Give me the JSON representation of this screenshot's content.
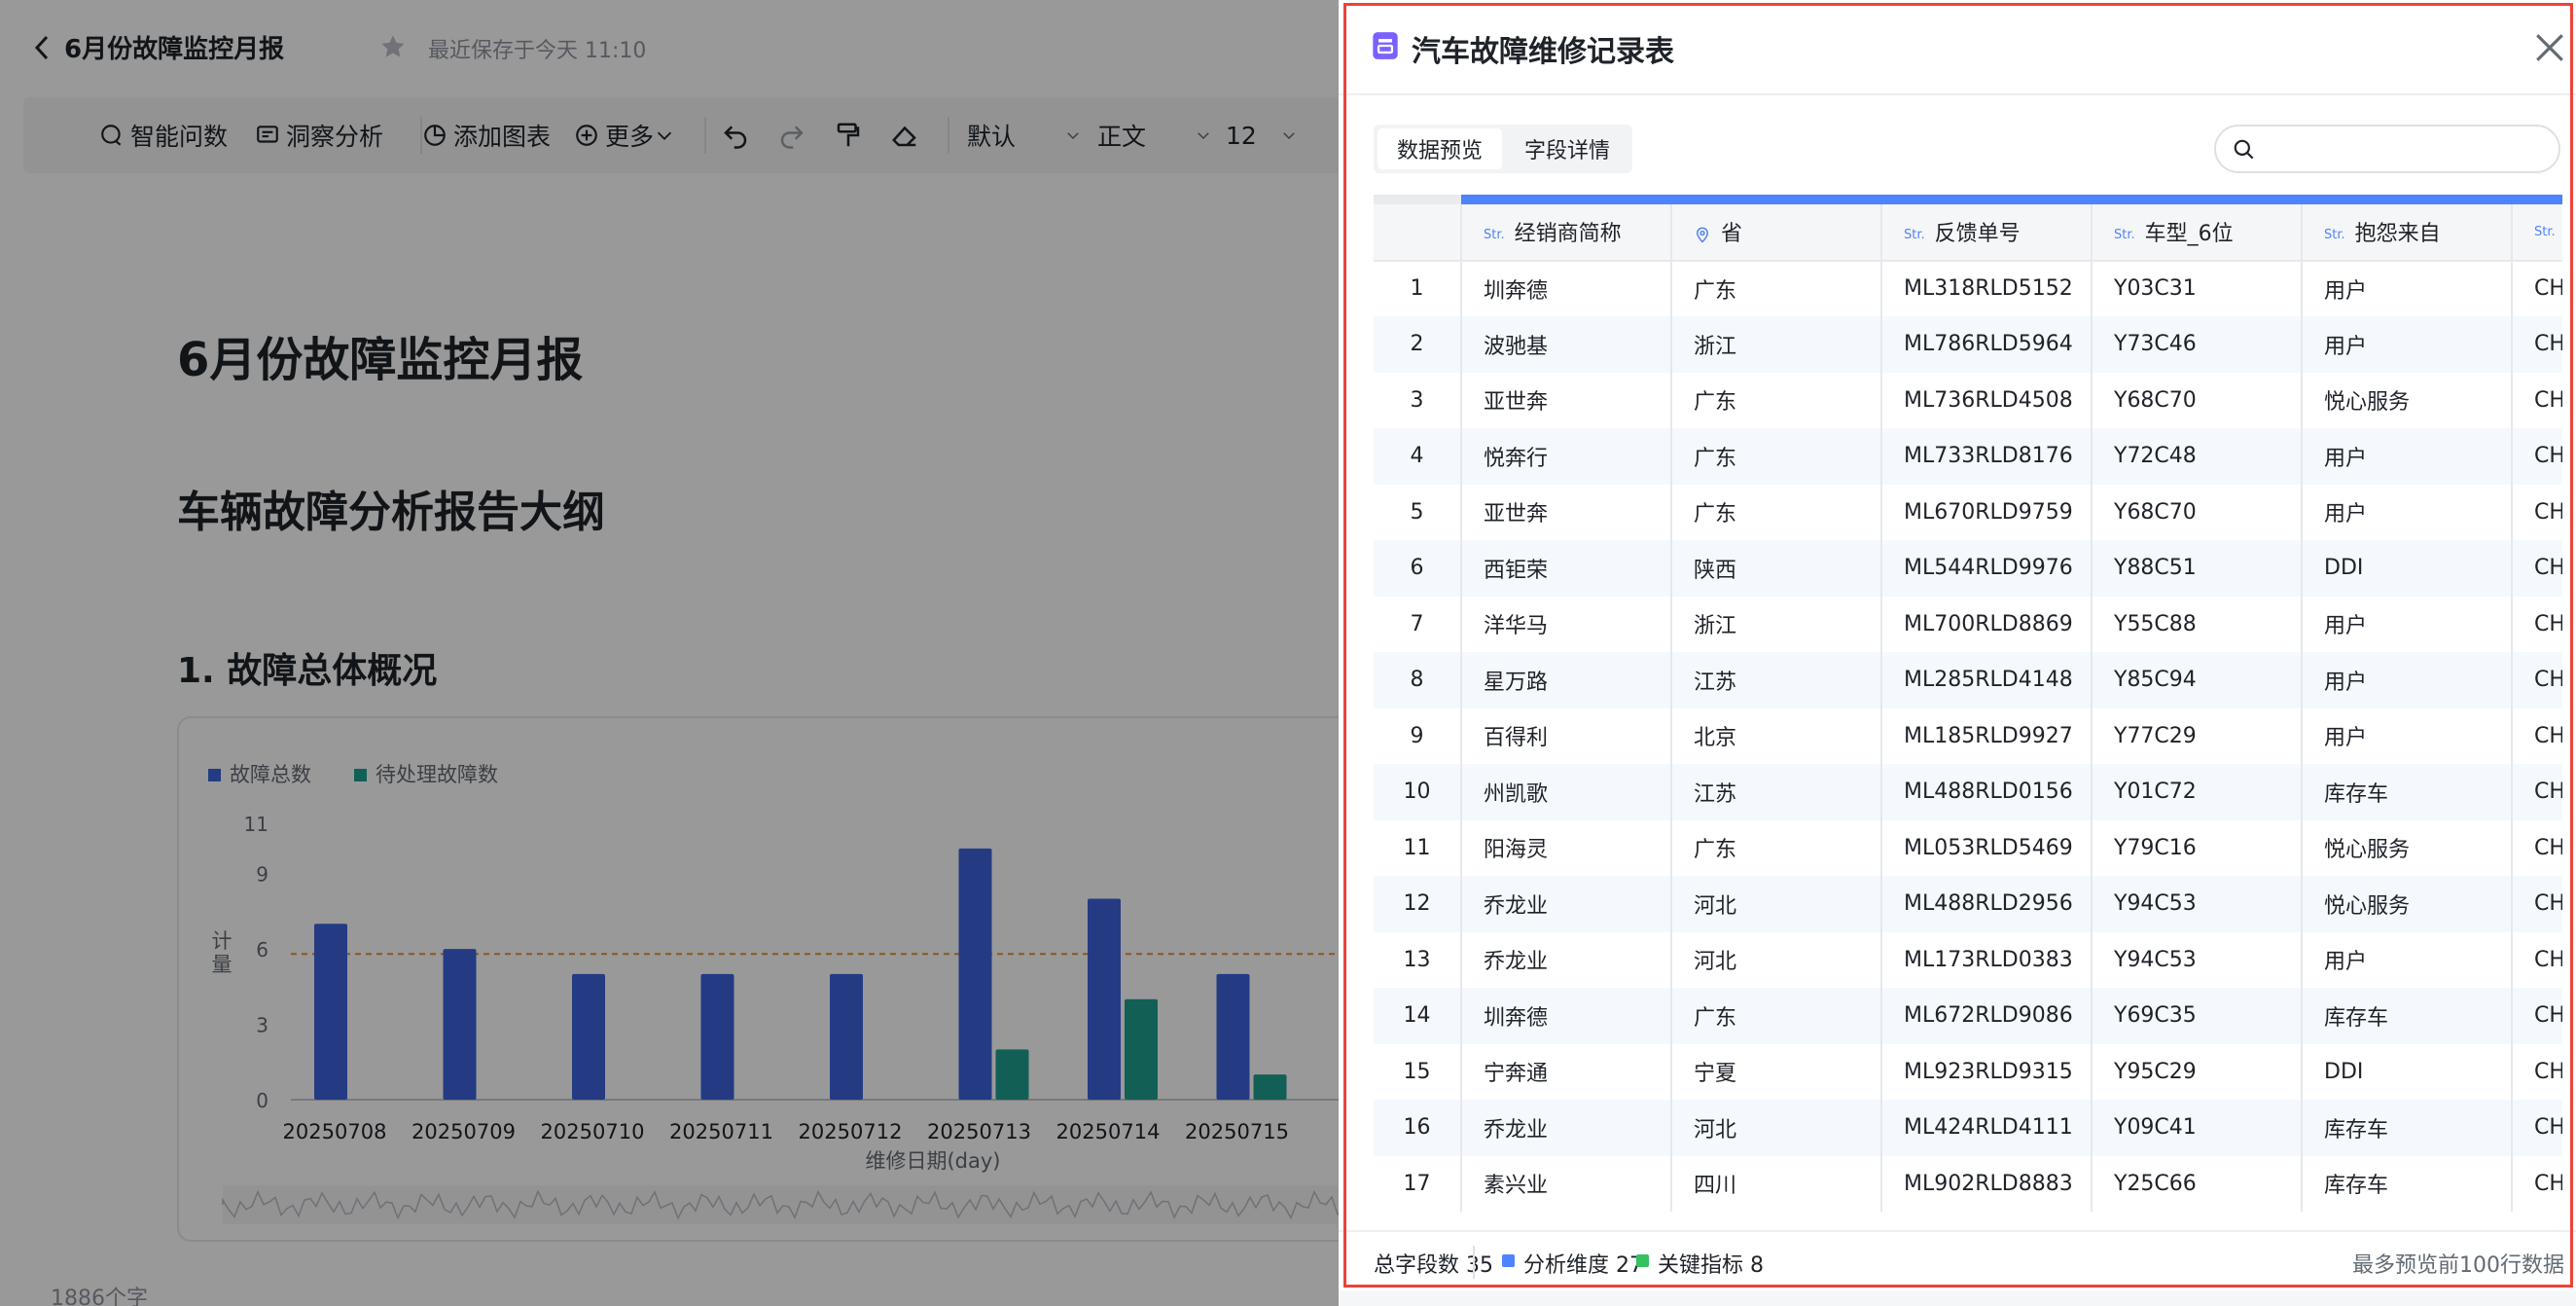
{
  "editor": {
    "doc_title": "6月份故障监控月报",
    "save_status": "最近保存于今天 11:10",
    "toolbar": {
      "ai_qa": "智能问数",
      "insight": "洞察分析",
      "add_chart": "添加图表",
      "more": "更多",
      "style_select": "默认",
      "text_select": "正文",
      "size_select": "12"
    },
    "h1": "6月份故障监控月报",
    "h2": "车辆故障分析报告大纲",
    "h3": "1. 故障总体概况",
    "word_count": "1886个字"
  },
  "chart_data": {
    "type": "bar",
    "categories": [
      "20250708",
      "20250709",
      "20250710",
      "20250711",
      "20250712",
      "20250713",
      "20250714",
      "20250715"
    ],
    "series": [
      {
        "name": "故障总数",
        "color": "#3d63dd",
        "values": [
          7,
          6,
          5,
          5,
          5,
          10,
          8,
          5
        ]
      },
      {
        "name": "待处理故障数",
        "color": "#1f9f8f",
        "values": [
          0,
          0,
          0,
          0,
          0,
          2,
          4,
          1
        ]
      }
    ],
    "xlabel": "维修日期(day)",
    "ylabel": "计量",
    "yticks": [
      0,
      3,
      6,
      9,
      11
    ],
    "ylim": [
      0,
      11
    ],
    "reference_line": 5.8,
    "legend": "top-left",
    "grid": false
  },
  "panel": {
    "title": "汽车故障维修记录表",
    "tabs": [
      {
        "label": "数据预览",
        "active": true
      },
      {
        "label": "字段详情",
        "active": false
      }
    ],
    "search_placeholder": "",
    "columns": [
      {
        "type": "Str.",
        "label": "经销商简称",
        "icon": "text-type-icon"
      },
      {
        "type": "",
        "label": "省",
        "icon": "location-pin-icon"
      },
      {
        "type": "Str.",
        "label": "反馈单号",
        "icon": "text-type-icon"
      },
      {
        "type": "Str.",
        "label": "车型_6位",
        "icon": "text-type-icon"
      },
      {
        "type": "Str.",
        "label": "抱怨来自",
        "icon": "text-type-icon"
      },
      {
        "type": "Str.",
        "label": "",
        "icon": "text-type-icon"
      }
    ],
    "rows": [
      [
        "1",
        "圳奔德",
        "广东",
        "ML318RLD5152",
        "Y03C31",
        "用户",
        "CH"
      ],
      [
        "2",
        "波驰基",
        "浙江",
        "ML786RLD5964",
        "Y73C46",
        "用户",
        "CH"
      ],
      [
        "3",
        "亚世奔",
        "广东",
        "ML736RLD4508",
        "Y68C70",
        "悦心服务",
        "CH"
      ],
      [
        "4",
        "悦奔行",
        "广东",
        "ML733RLD8176",
        "Y72C48",
        "用户",
        "CH"
      ],
      [
        "5",
        "亚世奔",
        "广东",
        "ML670RLD9759",
        "Y68C70",
        "用户",
        "CH"
      ],
      [
        "6",
        "西钜荣",
        "陕西",
        "ML544RLD9976",
        "Y88C51",
        "DDI",
        "CH"
      ],
      [
        "7",
        "洋华马",
        "浙江",
        "ML700RLD8869",
        "Y55C88",
        "用户",
        "CH"
      ],
      [
        "8",
        "星万路",
        "江苏",
        "ML285RLD4148",
        "Y85C94",
        "用户",
        "CH"
      ],
      [
        "9",
        "百得利",
        "北京",
        "ML185RLD9927",
        "Y77C29",
        "用户",
        "CH"
      ],
      [
        "10",
        "州凯歌",
        "江苏",
        "ML488RLD0156",
        "Y01C72",
        "库存车",
        "CH"
      ],
      [
        "11",
        "阳海灵",
        "广东",
        "ML053RLD5469",
        "Y79C16",
        "悦心服务",
        "CH"
      ],
      [
        "12",
        "乔龙业",
        "河北",
        "ML488RLD2956",
        "Y94C53",
        "悦心服务",
        "CH"
      ],
      [
        "13",
        "乔龙业",
        "河北",
        "ML173RLD0383",
        "Y94C53",
        "用户",
        "CH"
      ],
      [
        "14",
        "圳奔德",
        "广东",
        "ML672RLD9086",
        "Y69C35",
        "库存车",
        "CH"
      ],
      [
        "15",
        "宁奔通",
        "宁夏",
        "ML923RLD9315",
        "Y95C29",
        "DDI",
        "CH"
      ],
      [
        "16",
        "乔龙业",
        "河北",
        "ML424RLD4111",
        "Y09C41",
        "库存车",
        "CH"
      ],
      [
        "17",
        "素兴业",
        "四川",
        "ML902RLD8883",
        "Y25C66",
        "库存车",
        "CH"
      ]
    ],
    "footer": {
      "total_fields": "总字段数 35",
      "dimensions": "分析维度 27",
      "metrics": "关键指标 8",
      "preview_note": "最多预览前100行数据",
      "dimension_color": "#4e83fd",
      "metric_color": "#35c15e"
    }
  }
}
